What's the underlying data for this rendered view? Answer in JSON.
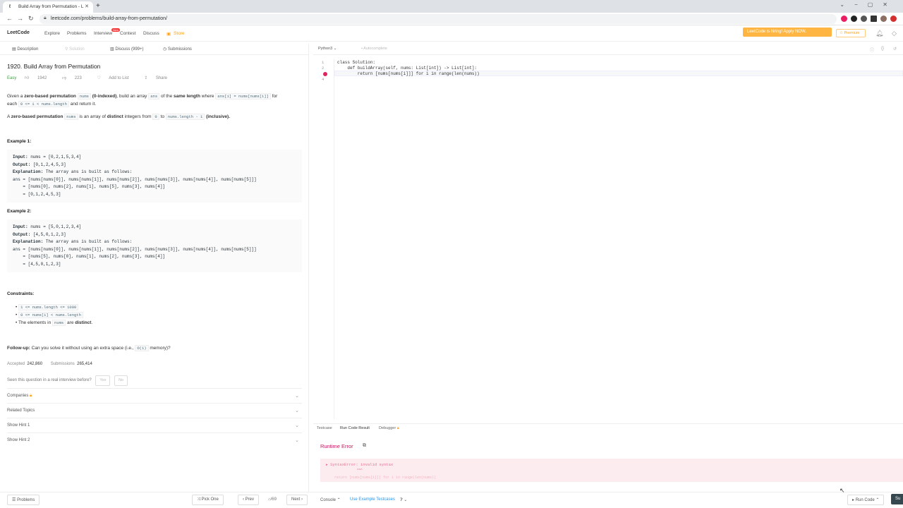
{
  "browser": {
    "tab_title": "Build Array from Permutation - L",
    "url": "leetcode.com/problems/build-array-from-permutation/"
  },
  "nav": {
    "logo": "LeetCode",
    "items": [
      "Explore",
      "Problems",
      "Interview",
      "Contest",
      "Discuss",
      "Store"
    ],
    "new_badge": "New",
    "hiring": "LeetCode is hiring! Apply NOW.",
    "premium": "Premium"
  },
  "left_tabs": [
    "Description",
    "Solution",
    "Discuss (999+)",
    "Submissions"
  ],
  "problem": {
    "title": "1920. Build Array from Permutation",
    "difficulty": "Easy",
    "likes": "1942",
    "dislikes": "223",
    "add_to_list": "Add to List",
    "share": "Share",
    "p1_a": "Given a",
    "p1_b": "zero-based permutation",
    "p1_c": "nums",
    "p1_d": "(0-indexed)",
    "p1_e": ", build an array",
    "p1_f": "ans",
    "p1_g": "of the",
    "p1_h": "same length",
    "p1_i": "where",
    "p1_j": "ans[i] = nums[nums[i]]",
    "p1_k": "for",
    "p1_l": "each",
    "p1_m": "0 <= i < nums.length",
    "p1_n": "and return it.",
    "p2_a": "A",
    "p2_b": "zero-based permutation",
    "p2_c": "nums",
    "p2_d": "is an array of",
    "p2_e": "distinct",
    "p2_f": "integers from",
    "p2_g": "0",
    "p2_h": "to",
    "p2_i": "nums.length - 1",
    "p2_j": "(inclusive).",
    "ex1_title": "Example 1:",
    "ex1_input_label": "Input:",
    "ex1_input": " nums = [0,2,1,5,3,4]",
    "ex1_output_label": "Output:",
    "ex1_output": " [0,1,2,4,5,3]",
    "ex1_expl_label": "Explanation:",
    "ex1_expl": " The array ans is built as follows:",
    "ex1_l1": "ans = [nums[nums[0]], nums[nums[1]], nums[nums[2]], nums[nums[3]], nums[nums[4]], nums[nums[5]]]",
    "ex1_l2": "    = [nums[0], nums[2], nums[1], nums[5], nums[3], nums[4]]",
    "ex1_l3": "    = [0,1,2,4,5,3]",
    "ex2_title": "Example 2:",
    "ex2_input_label": "Input:",
    "ex2_input": " nums = [5,0,1,2,3,4]",
    "ex2_output_label": "Output:",
    "ex2_output": " [4,5,0,1,2,3]",
    "ex2_expl_label": "Explanation:",
    "ex2_expl": " The array ans is built as follows:",
    "ex2_l1": "ans = [nums[nums[0]], nums[nums[1]], nums[nums[2]], nums[nums[3]], nums[nums[4]], nums[nums[5]]]",
    "ex2_l2": "    = [nums[5], nums[0], nums[1], nums[2], nums[3], nums[4]]",
    "ex2_l3": "    = [4,5,0,1,2,3]",
    "constraints_title": "Constraints:",
    "c1": "1 <= nums.length <= 1000",
    "c2": "0 <= nums[i] < nums.length",
    "c3_a": "The elements in",
    "c3_b": "nums",
    "c3_c": "are",
    "c3_d": "distinct",
    "c3_e": ".",
    "followup_label": "Follow-up:",
    "followup_text": "Can you solve it without using an extra space (i.e.,",
    "followup_code": "O(1)",
    "followup_end": "memory)?",
    "accepted_label": "Accepted",
    "accepted": "242,860",
    "submissions_label": "Submissions",
    "submissions": "265,414",
    "interview_q": "Seen this question in a real interview before?",
    "yes": "Yes",
    "no": "No",
    "sections": [
      "Companies",
      "Related Topics",
      "Show Hint 1",
      "Show Hint 2"
    ]
  },
  "bottom": {
    "problems": "Problems",
    "pick_one": "Pick One",
    "prev": "Prev",
    "page": "/69",
    "next": "Next",
    "console": "Console",
    "use_example": "Use Example Testcases",
    "run_code": "Run Code",
    "submit": "Su"
  },
  "editor": {
    "language": "Python3",
    "autocomplete": "Autocomplete",
    "line_numbers": [
      "1",
      "2",
      "3",
      "4"
    ],
    "lines": [
      "class Solution:",
      "    def buildArray(self, nums: List[int]) -> List[int]:",
      "        return [nums[nums[i]]] for i in range(len(nums))",
      ""
    ]
  },
  "result": {
    "tabs": [
      "Testcase",
      "Run Code Result",
      "Debugger"
    ],
    "status": "Runtime Error",
    "error": "SyntaxError: invalid syntax",
    "caret": "^^^",
    "error_line": "return [nums[nums[i]]] for i in range(len(nums))"
  }
}
